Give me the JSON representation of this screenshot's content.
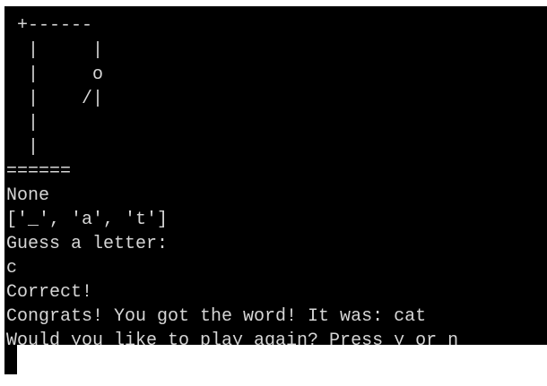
{
  "terminal": {
    "lines": [
      " +------",
      "  |     |",
      "  |     o",
      "  |    /|",
      "  |",
      "  |",
      "======",
      "None",
      "['_', 'a', 't']",
      "Guess a letter:",
      "c",
      "Correct!",
      "Congrats! You got the word! It was: cat",
      "Would you like to play again? Press y or n"
    ]
  },
  "colors": {
    "background": "#000000",
    "text": "#d6d6d6"
  }
}
